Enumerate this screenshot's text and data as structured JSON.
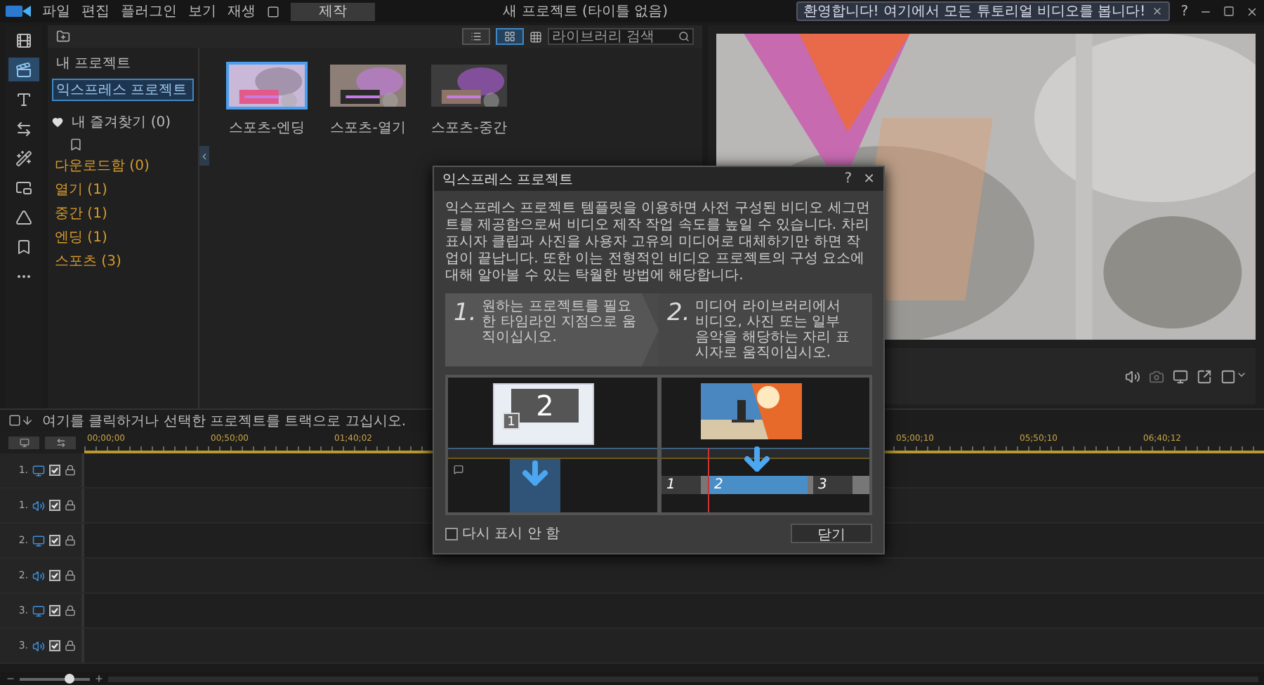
{
  "app": {
    "menu": [
      "파일",
      "편집",
      "플러그인",
      "보기",
      "재생"
    ],
    "produce_button": "제작",
    "title": "새 프로젝트 (타이틀 없음)",
    "welcome_banner": "환영합니다! 여기에서 모든 튜토리얼 비디오를 봅니다!",
    "help": "?"
  },
  "side_tabs": [
    {
      "kind": "media",
      "selected": false
    },
    {
      "kind": "template",
      "selected": true
    },
    {
      "kind": "title",
      "selected": false
    },
    {
      "kind": "transition",
      "selected": false
    },
    {
      "kind": "effect",
      "selected": false
    },
    {
      "kind": "overlay",
      "selected": false
    },
    {
      "kind": "particle",
      "selected": false
    },
    {
      "kind": "chapter",
      "selected": false
    },
    {
      "kind": "more",
      "selected": false
    }
  ],
  "library": {
    "view_modes": [
      {
        "kind": "details",
        "selected": false
      },
      {
        "kind": "thumbnails",
        "selected": true
      }
    ],
    "search": {
      "placeholder": "라이브러리 검색"
    },
    "tree": [
      {
        "label": "내 프로젝트",
        "selected": false
      },
      {
        "label": "익스프레스 프로젝트",
        "selected": true
      }
    ],
    "favorites": "내 즐겨찾기 (0)",
    "categories": [
      "다운로드함 (0)",
      "열기 (1)",
      "중간 (1)",
      "엔딩 (1)",
      "스포츠 (3)"
    ],
    "items": [
      {
        "label": "스포츠-엔딩",
        "selected": true
      },
      {
        "label": "스포츠-열기",
        "selected": false
      },
      {
        "label": "스포츠-중간",
        "selected": false
      }
    ]
  },
  "timeline": {
    "hint": "여기를 클릭하거나 선택한 프로젝트를 트랙으로 끄십시오.",
    "ruler_start": [
      "00;00;00",
      "00;50;00",
      "01;40;02"
    ],
    "ruler_end": [
      "05;00;10",
      "05;50;10",
      "06;40;12"
    ],
    "tracks": [
      {
        "number": "1.",
        "kind": "video",
        "checked": true
      },
      {
        "number": "1.",
        "kind": "audio",
        "checked": true
      },
      {
        "number": "2.",
        "kind": "video",
        "checked": true
      },
      {
        "number": "2.",
        "kind": "audio",
        "checked": true
      },
      {
        "number": "3.",
        "kind": "video",
        "checked": true
      },
      {
        "number": "3.",
        "kind": "audio",
        "checked": true
      }
    ],
    "zoom": {
      "level": 0.7
    }
  },
  "dialog": {
    "title": "익스프레스 프로젝트",
    "help": "?",
    "close": "×",
    "description": "익스프레스 프로젝트 템플릿을 이용하면 사전 구성된 비디오 세그먼트를 제공함으로써 비디오 제작 작업 속도를 높일 수 있습니다. 차리 표시자 클립과 사진을 사용자 고유의 미디어로 대체하기만 하면 작업이 끝납니다. 또한 이는 전형적인 비디오 프로젝트의 구성 요소에 대해 알아볼 수 있는 탁월한 방법에 해당합니다.",
    "steps": [
      {
        "number": "1.",
        "text": "원하는 프로젝트를 필요한 타임라인 지점으로 움직이십시오."
      },
      {
        "number": "2.",
        "text": "미디어 라이브러리에서 비디오, 사진 또는 일부 음악을 해당하는 자리 표시자로 움직이십시오."
      }
    ],
    "template_card": {
      "main": "2",
      "small": "1"
    },
    "clips": [
      "1",
      "2",
      "3"
    ],
    "dont_show_again": {
      "label": "다시 표시 안 함",
      "checked": false
    },
    "close_button": "닫기"
  }
}
